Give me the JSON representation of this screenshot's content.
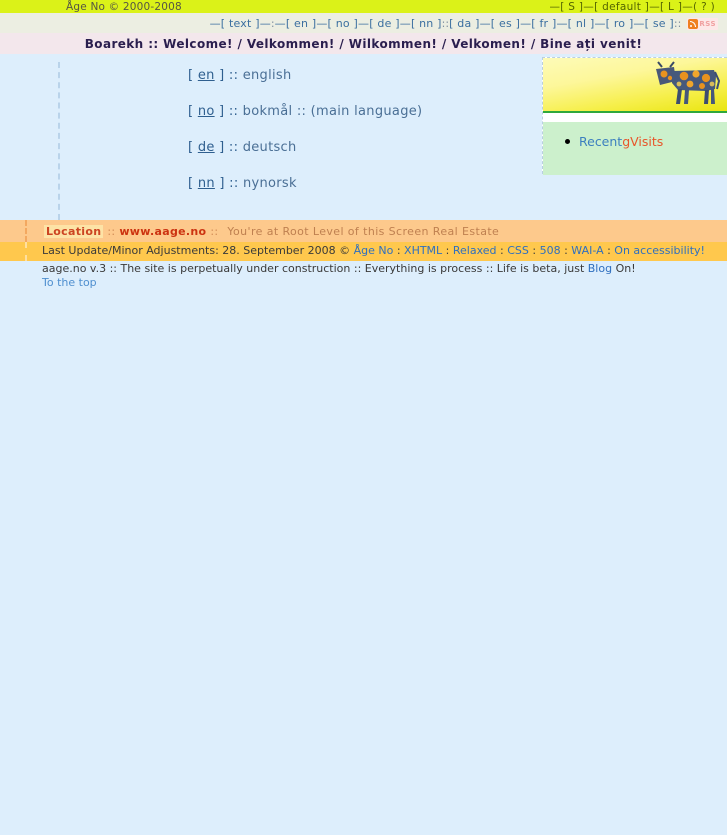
{
  "topbar": {
    "copyright": "Åge No © 2000-2008",
    "size_small": "—[ S ]—",
    "size_default": "[ default ]—",
    "size_large": "[ L ]—",
    "help": "( ? )"
  },
  "nav": {
    "text_label": "—[ text ]—",
    "colon": " : ",
    "primary": "—[ en ]—[ no ]—[ de ]—[ nn ]",
    "divider": " :: ",
    "secondary": "[ da ]—[ es ]—[ fr ]—[ nl ]—[ ro ]—[ se ]",
    "trailing": " ::",
    "rss_label": "RSS"
  },
  "welcome": {
    "text": "Boarekh :: Welcome! / Velkommen! / Wilkommen! / Velkomen! / Bine ați venit!"
  },
  "languages": [
    {
      "open": "[ ",
      "code": "en",
      "close": " ] :: ",
      "name": "english"
    },
    {
      "open": "[ ",
      "code": "no",
      "close": " ] :: ",
      "name": "bokmål :: (main language)"
    },
    {
      "open": "[ ",
      "code": "de",
      "close": " ] :: ",
      "name": "deutsch"
    },
    {
      "open": "[ ",
      "code": "nn",
      "close": " ] :: ",
      "name": "nynorsk"
    }
  ],
  "sidepanel": {
    "image_alt": "cow-illustration",
    "link_recent": "Recent ",
    "link_gvisits": "gVisits"
  },
  "location": {
    "label": "Location",
    "sep1": "::",
    "url": "www.aage.no",
    "sep2": "::",
    "description": "You're at Root Level of this Screen Real Estate"
  },
  "footer": {
    "line1_prefix": "Last Update/Minor Adjustments: 28. September 2008 © ",
    "line1_author": "Åge No",
    "line1_mid": " : ",
    "link_xhtml": "XHTML",
    "link_relaxed": "Relaxed",
    "link_css": "CSS",
    "link_508": "508",
    "link_waia": "WAI-A",
    "link_accessibility": "On accessibility!",
    "colon_sep": " : ",
    "line2_prefix": "aage.no v.3 :: The site is perpetually under construction :: Everything is process :: Life is beta, just ",
    "line2_link": "Blog",
    "line2_suffix": " On!",
    "to_the_top": "To the top"
  },
  "colors": {
    "topbar_yellow": "#dbf218",
    "nav_grey": "#eceee2",
    "welcome_pink": "#f3e7ec",
    "body_blue": "#ddeefc",
    "location_orange": "#fdc98c",
    "footer_orange": "#ffc84d",
    "accent_red": "#cc3311",
    "link_blue": "#2f6fbf",
    "panel_green": "#ccf0cc"
  }
}
